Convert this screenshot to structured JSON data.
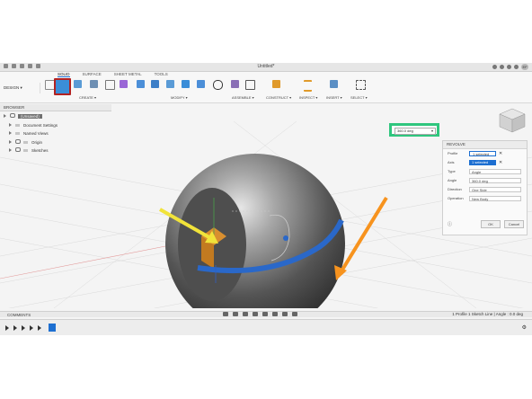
{
  "window": {
    "title": "Untitled*",
    "user_initials": "EF"
  },
  "ribbon": {
    "design_label": "DESIGN ▾",
    "tabs": [
      "SOLID",
      "SURFACE",
      "SHEET METAL",
      "TOOLS"
    ],
    "groups": [
      "CREATE ▾",
      "MODIFY ▾",
      "ASSEMBLE ▾",
      "CONSTRUCT ▾",
      "INSPECT ▾",
      "INSERT ▾",
      "SELECT ▾"
    ]
  },
  "browser": {
    "title": "BROWSER",
    "items": [
      "(Unsaved)",
      "Document Settings",
      "Named Views",
      "Origin",
      "Sketches"
    ]
  },
  "angle_input": {
    "value": "360.0 deg"
  },
  "revolve": {
    "title": "REVOLVE",
    "rows": [
      {
        "label": "Profile",
        "value": "1 selected"
      },
      {
        "label": "Axis",
        "value": "1 selected"
      },
      {
        "label": "Type",
        "value": "Angle"
      },
      {
        "label": "Angle",
        "value": "360.0 deg"
      },
      {
        "label": "Direction",
        "value": "One Side"
      },
      {
        "label": "Operation",
        "value": "New Body"
      }
    ],
    "ok": "OK",
    "cancel": "Cancel"
  },
  "comments": {
    "label": "COMMENTS"
  },
  "status": {
    "text": "1 Profile 1 Sketch Line | Angle : 0.0 deg"
  },
  "colors": {
    "accent": "#1d6fd1",
    "highlight_box": "#2fc67e",
    "annotation_red": "#b22222",
    "arrow_yellow": "#f1e33a",
    "arrow_orange": "#f7931e"
  }
}
